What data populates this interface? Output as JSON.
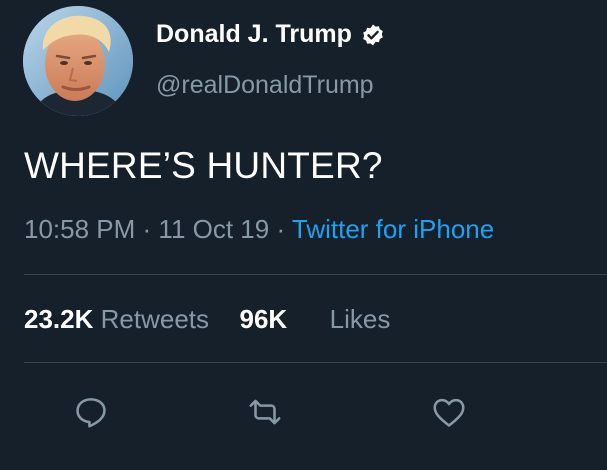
{
  "author": {
    "display_name": "Donald J. Trump",
    "handle": "@realDonaldTrump",
    "verified": true
  },
  "tweet": {
    "text": "WHERE’S HUNTER?",
    "time": "10:58 PM",
    "date": "11 Oct 19",
    "source": "Twitter for iPhone"
  },
  "stats": {
    "retweets_count": "23.2K",
    "retweets_label": "Retweets",
    "likes_count": "96K",
    "likes_label": "Likes"
  },
  "actions": {
    "reply_icon": "comment-icon",
    "retweet_icon": "retweet-icon",
    "like_icon": "heart-icon"
  },
  "colors": {
    "background": "#15202b",
    "secondary_text": "#8899a6",
    "link": "#1da1f2",
    "divider": "#38444d"
  }
}
